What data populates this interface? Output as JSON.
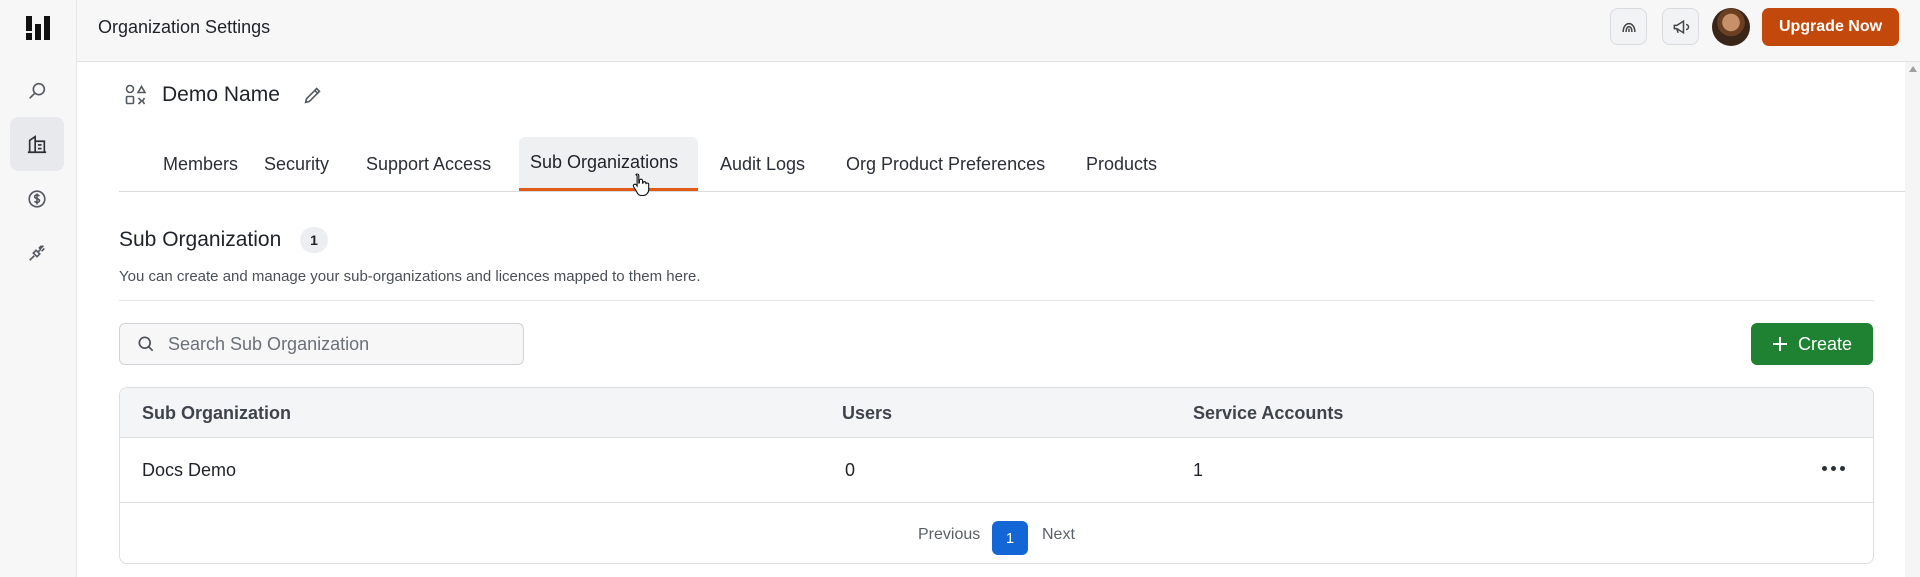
{
  "app": {
    "page_title": "Organization Settings",
    "upgrade_label": "Upgrade Now",
    "accent_color": "#c2480c"
  },
  "rail": {
    "items": [
      {
        "name": "search",
        "icon": "search-icon"
      },
      {
        "name": "organization",
        "icon": "building-icon",
        "active": true
      },
      {
        "name": "billing",
        "icon": "dollar-icon"
      },
      {
        "name": "integrations",
        "icon": "plug-icon"
      }
    ]
  },
  "org": {
    "name": "Demo Name"
  },
  "tabs": [
    {
      "label": "Members"
    },
    {
      "label": "Security"
    },
    {
      "label": "Support Access"
    },
    {
      "label": "Sub Organizations",
      "active": true
    },
    {
      "label": "Audit Logs"
    },
    {
      "label": "Org Product Preferences"
    },
    {
      "label": "Products"
    }
  ],
  "section": {
    "title": "Sub Organization",
    "count": "1",
    "description": "You can create and manage your sub-organizations and licences mapped to them here."
  },
  "search": {
    "placeholder": "Search Sub Organization",
    "value": ""
  },
  "create_label": "Create",
  "table": {
    "columns": [
      "Sub Organization",
      "Users",
      "Service Accounts"
    ],
    "rows": [
      {
        "name": "Docs Demo",
        "users": "0",
        "service_accounts": "1"
      }
    ]
  },
  "pagination": {
    "previous": "Previous",
    "current": "1",
    "next": "Next"
  }
}
